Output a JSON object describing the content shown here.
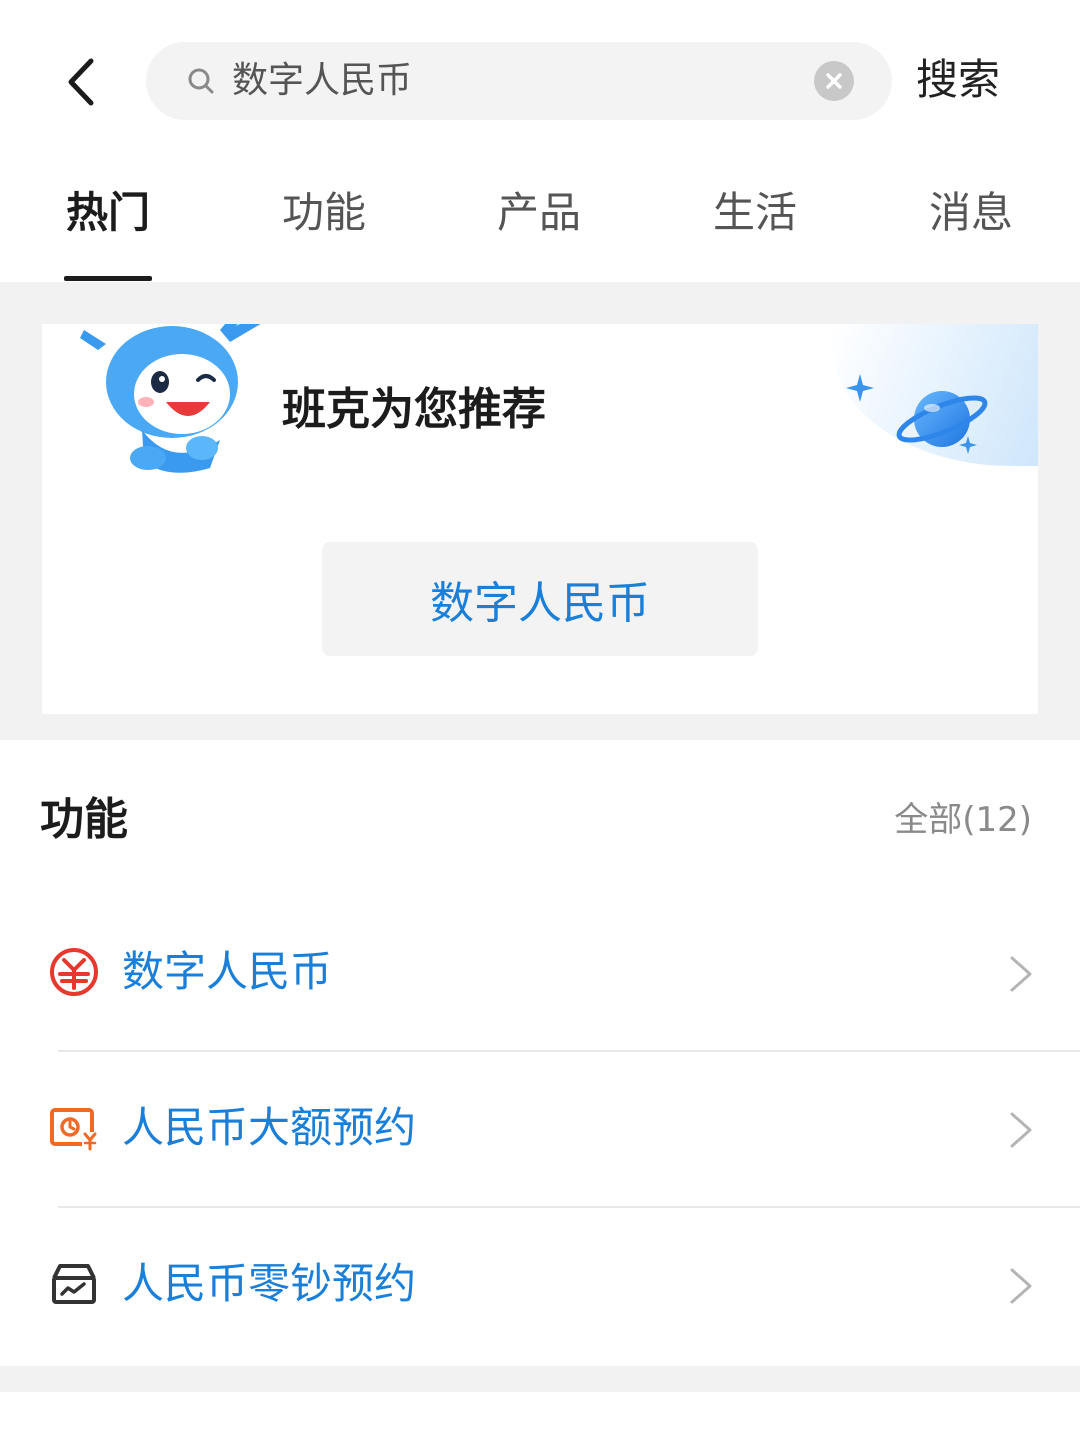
{
  "search": {
    "query": "数字人民币",
    "button_label": "搜索"
  },
  "tabs": [
    {
      "label": "热门",
      "active": true
    },
    {
      "label": "功能",
      "active": false
    },
    {
      "label": "产品",
      "active": false
    },
    {
      "label": "生活",
      "active": false
    },
    {
      "label": "消息",
      "active": false
    }
  ],
  "recommend": {
    "title": "班克为您推荐",
    "chip": "数字人民币"
  },
  "functions": {
    "title": "功能",
    "all_label": "全部(12)",
    "items": [
      {
        "label": "数字人民币",
        "icon": "digital-rmb-icon"
      },
      {
        "label": "人民币大额预约",
        "icon": "large-cash-appointment-icon"
      },
      {
        "label": "人民币零钞预约",
        "icon": "small-change-appointment-icon"
      }
    ]
  },
  "colors": {
    "accent_blue": "#1a7fd9",
    "icon_red": "#e8372c",
    "icon_orange": "#f06a25",
    "icon_dark": "#333333"
  }
}
